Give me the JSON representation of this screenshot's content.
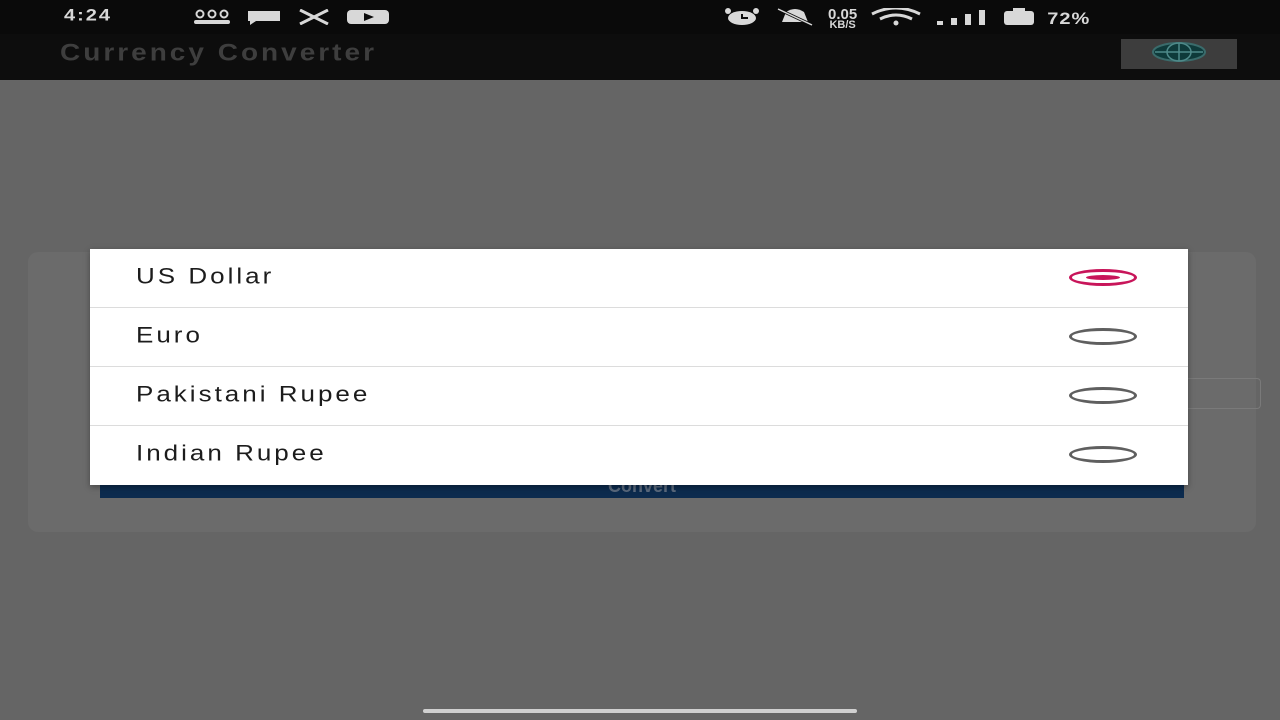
{
  "status_bar": {
    "time": "4:24",
    "left_icons": [
      "group-icon",
      "chat-icon",
      "x-icon",
      "youtube-icon"
    ],
    "net_speed_value": "0.05",
    "net_speed_unit": "KB/S",
    "battery": "72%",
    "right_icons": [
      "alarm-icon",
      "mute-icon",
      "wifi-icon",
      "signal-icon",
      "battery-icon"
    ]
  },
  "app_bar": {
    "title": "Currency Converter",
    "logo_icon": "globe-icon"
  },
  "background": {
    "button_label": "Convert"
  },
  "dialog": {
    "options": [
      {
        "label": "US Dollar",
        "selected": true
      },
      {
        "label": "Euro",
        "selected": false
      },
      {
        "label": "Pakistani Rupee",
        "selected": false
      },
      {
        "label": "Indian Rupee",
        "selected": false
      }
    ]
  },
  "colors": {
    "accent": "#c8155a",
    "scrim": "#656565",
    "dialog_bg": "#ffffff",
    "appbar_bg": "#0d0d0d",
    "button_bg": "#0c2b4e"
  }
}
